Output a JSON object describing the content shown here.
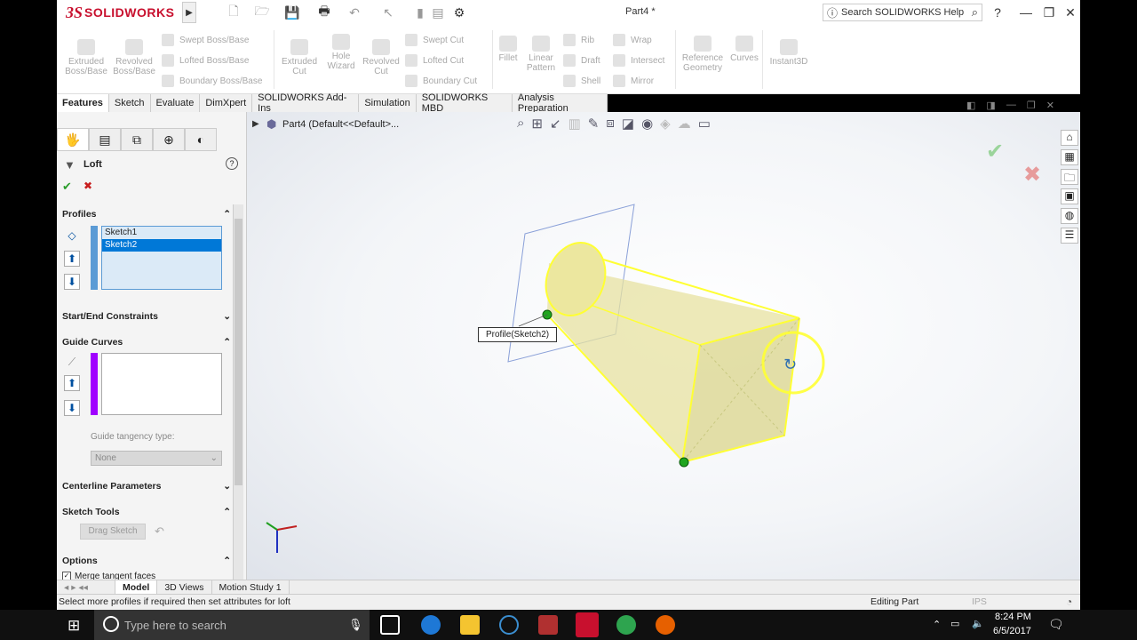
{
  "app": {
    "brand_ds": "3S",
    "brand_name": "SOLIDWORKS",
    "doc_title": "Part4 *",
    "search_placeholder": "Search SOLIDWORKS Help",
    "help": "?",
    "minimize": "—",
    "restore": "❐",
    "close": "✕"
  },
  "ribbon": {
    "extruded_boss": "Extruded Boss/Base",
    "revolved_boss": "Revolved Boss/Base",
    "swept_boss": "Swept Boss/Base",
    "lofted_boss": "Lofted Boss/Base",
    "boundary_boss": "Boundary Boss/Base",
    "extruded_cut": "Extruded Cut",
    "hole_wizard": "Hole Wizard",
    "revolved_cut": "Revolved Cut",
    "swept_cut": "Swept Cut",
    "lofted_cut": "Lofted Cut",
    "boundary_cut": "Boundary Cut",
    "fillet": "Fillet",
    "linear_pattern": "Linear Pattern",
    "rib": "Rib",
    "draft": "Draft",
    "shell": "Shell",
    "wrap": "Wrap",
    "intersect": "Intersect",
    "mirror": "Mirror",
    "reference_geometry": "Reference Geometry",
    "curves": "Curves",
    "instant3d": "Instant3D"
  },
  "tabs": [
    "Features",
    "Sketch",
    "Evaluate",
    "DimXpert",
    "SOLIDWORKS Add-Ins",
    "Simulation",
    "SOLIDWORKS MBD",
    "Analysis Preparation"
  ],
  "property_manager": {
    "title": "Loft",
    "help": "?",
    "ok": "✔",
    "cancel": "✖",
    "profiles_label": "Profiles",
    "profiles": [
      "Sketch1",
      "Sketch2"
    ],
    "start_end_label": "Start/End Constraints",
    "guide_curves_label": "Guide Curves",
    "guide_tangency_label": "Guide tangency type:",
    "guide_tangency_value": "None",
    "centerline_label": "Centerline Parameters",
    "sketch_tools_label": "Sketch Tools",
    "drag_sketch": "Drag Sketch",
    "options_label": "Options",
    "merge_tangent": "Merge tangent faces"
  },
  "viewport": {
    "tree_root": "Part4  (Default<<Default>...",
    "profile_callout": "Profile(Sketch2)"
  },
  "bottom_tabs": [
    "Model",
    "3D Views",
    "Motion Study 1"
  ],
  "status": {
    "message": "Select more profiles if required then set attributes for loft",
    "mode": "Editing Part",
    "units": "IPS"
  },
  "taskbar": {
    "search_placeholder": "Type here to search",
    "time": "8:24 PM",
    "date": "6/5/2017"
  },
  "colors": {
    "accent": "#0078d7",
    "brand": "#c8102e",
    "loft_fill": "#e7e2a0",
    "selection": "#ffff33",
    "guide_curve_bar": "#a000ff",
    "profile_bar": "#5b9bd5"
  }
}
